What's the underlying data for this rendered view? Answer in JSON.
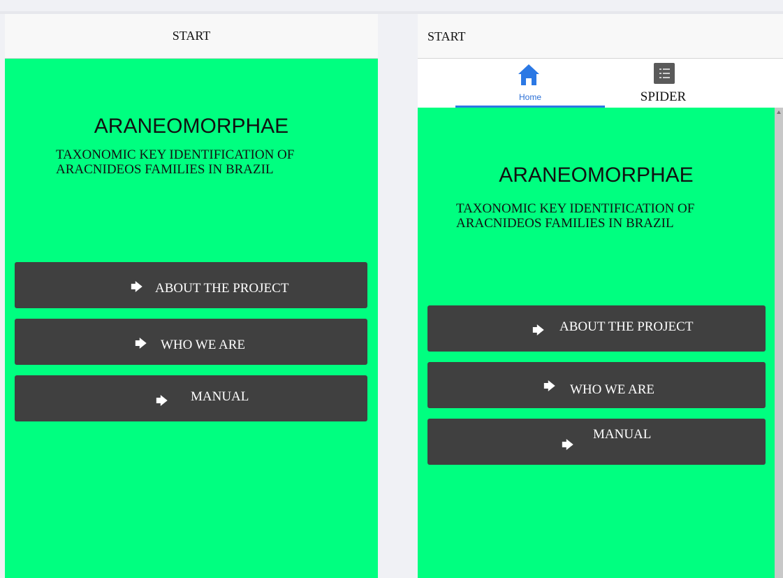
{
  "left": {
    "header_title": "START",
    "app_title": "ARANEOMORPHAE",
    "subtitle": "TAXONOMIC KEY IDENTIFICATION OF ARACNIDEOS FAMILIES IN BRAZIL",
    "buttons": [
      {
        "label": "ABOUT THE PROJECT",
        "icon": "arrow-right-icon"
      },
      {
        "label": "WHO WE ARE",
        "icon": "arrow-right-icon"
      },
      {
        "label": "MANUAL",
        "icon": "arrow-right-icon"
      }
    ]
  },
  "right": {
    "header_title": "START",
    "tabs": [
      {
        "label": "Home",
        "icon": "home-icon",
        "active": true
      },
      {
        "label": "SPIDER",
        "icon": "list-icon",
        "active": false
      }
    ],
    "app_title": "ARANEOMORPHAE",
    "subtitle": "TAXONOMIC KEY IDENTIFICATION OF ARACNIDEOS FAMILIES IN BRAZIL",
    "buttons": [
      {
        "label": "ABOUT THE PROJECT",
        "icon": "arrow-right-icon"
      },
      {
        "label": "WHO WE ARE",
        "icon": "arrow-right-icon"
      },
      {
        "label": "MANUAL",
        "icon": "arrow-right-icon"
      }
    ]
  },
  "colors": {
    "content_bg": "#00ff80",
    "button_bg": "#404040",
    "button_text": "#ffffff",
    "header_bg": "#f8f8f8",
    "tab_active": "#2b78e4"
  }
}
